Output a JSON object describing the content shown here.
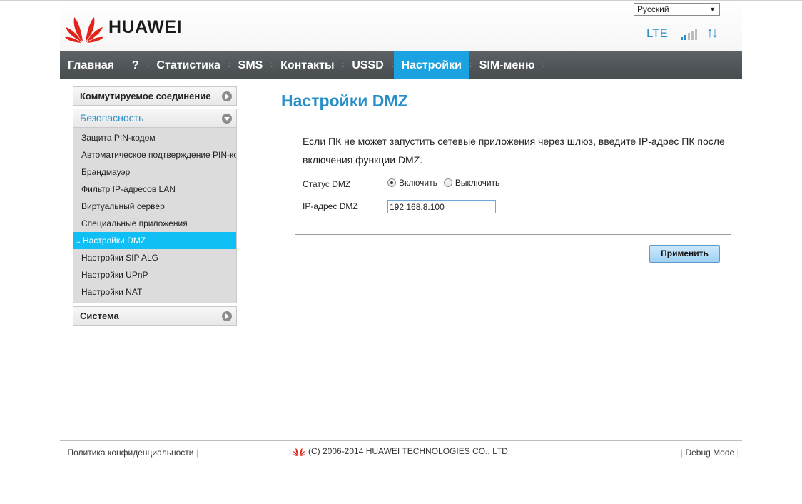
{
  "header": {
    "brand": "HUAWEI",
    "language": "Русский",
    "network_type": "LTE",
    "signal_bars": 2,
    "signal_bars_total": 5
  },
  "nav": {
    "items": [
      {
        "label": "Главная",
        "active": false
      },
      {
        "label": "?",
        "active": false
      },
      {
        "label": "Статистика",
        "active": false
      },
      {
        "label": "SMS",
        "active": false
      },
      {
        "label": "Контакты",
        "active": false
      },
      {
        "label": "USSD",
        "active": false
      },
      {
        "label": "Настройки",
        "active": true
      },
      {
        "label": "SIM-меню",
        "active": false
      }
    ]
  },
  "sidebar": {
    "groups": [
      {
        "label": "Коммутируемое соединение",
        "expanded": false
      },
      {
        "label": "Безопасность",
        "expanded": true
      },
      {
        "label": "Система",
        "expanded": false
      }
    ],
    "security_items": [
      {
        "label": "Защита PIN-кодом"
      },
      {
        "label": "Автоматическое подтверждение PIN-ко"
      },
      {
        "label": "Брандмауэр"
      },
      {
        "label": "Фильтр IP-адресов LAN"
      },
      {
        "label": "Виртуальный сервер"
      },
      {
        "label": "Специальные приложения"
      },
      {
        "label": "Настройки DMZ"
      },
      {
        "label": "Настройки SIP ALG"
      },
      {
        "label": "Настройки UPnP"
      },
      {
        "label": "Настройки NAT"
      }
    ],
    "active_item": "Настройки DMZ",
    "active_marker": "→"
  },
  "main": {
    "title": "Настройки DMZ",
    "description": "Если ПК не может запустить сетевые приложения через шлюз, введите IP-адрес ПК после включения функции DMZ.",
    "dmz_status_label": "Статус DMZ",
    "enable_label": "Включить",
    "disable_label": "Выключить",
    "dmz_enabled": true,
    "ip_label": "IP-адрес DMZ",
    "ip_value": "192.168.8.100",
    "apply_label": "Применить"
  },
  "footer": {
    "privacy_link": "Политика конфиденциальности",
    "copyright": "(C) 2006-2014 HUAWEI TECHNOLOGIES CO., LTD.",
    "debug_link": "Debug Mode"
  },
  "colors": {
    "accent": "#2a8fc8",
    "nav_active": "#1aa3e0",
    "sidebar_active": "#10c0f5",
    "nav_bg": "#4f5457",
    "brand_red": "#e2231a"
  }
}
